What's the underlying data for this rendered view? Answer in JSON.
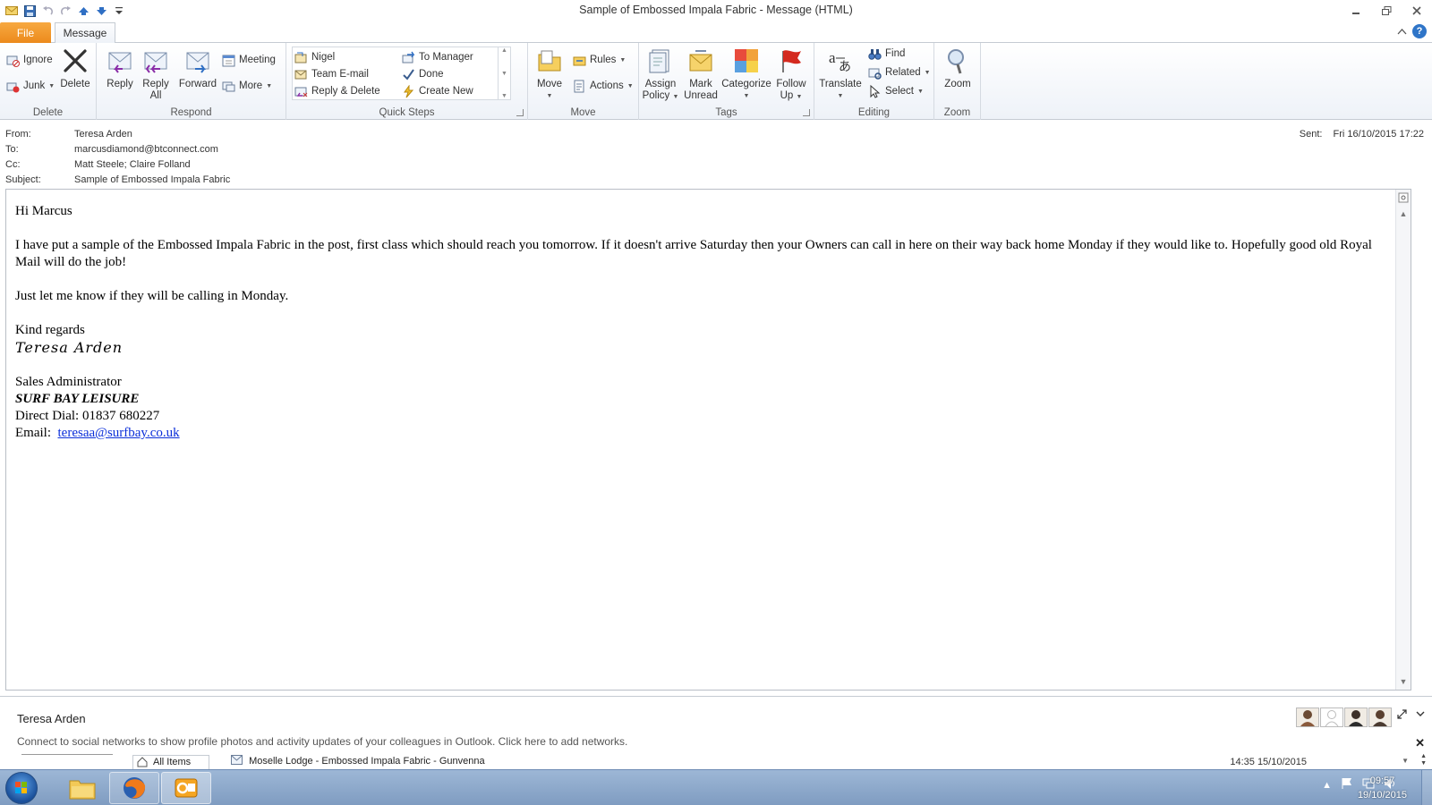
{
  "window": {
    "title": "Sample of Embossed Impala Fabric  -  Message (HTML)"
  },
  "tabs": {
    "file": "File",
    "message": "Message"
  },
  "ribbon": {
    "delete_group": {
      "label": "Delete",
      "ignore": "Ignore",
      "junk": "Junk",
      "delete": "Delete"
    },
    "respond_group": {
      "label": "Respond",
      "reply": "Reply",
      "reply_all_1": "Reply",
      "reply_all_2": "All",
      "forward": "Forward",
      "meeting": "Meeting",
      "more": "More"
    },
    "quick_steps_group": {
      "label": "Quick Steps",
      "items": [
        "Nigel",
        "To Manager",
        "Team E-mail",
        "Done",
        "Reply & Delete",
        "Create New"
      ]
    },
    "move_group": {
      "label": "Move",
      "move": "Move",
      "rules": "Rules",
      "actions": "Actions"
    },
    "tags_group": {
      "label": "Tags",
      "assign_policy_1": "Assign",
      "assign_policy_2": "Policy",
      "mark_unread_1": "Mark",
      "mark_unread_2": "Unread",
      "categorize": "Categorize",
      "follow_up_1": "Follow",
      "follow_up_2": "Up"
    },
    "editing_group": {
      "label": "Editing",
      "translate": "Translate",
      "find": "Find",
      "related": "Related",
      "select": "Select"
    },
    "zoom_group": {
      "label": "Zoom",
      "zoom": "Zoom"
    }
  },
  "header": {
    "from_label": "From:",
    "from": "Teresa Arden",
    "to_label": "To:",
    "to": "marcusdiamond@btconnect.com",
    "cc_label": "Cc:",
    "cc": "Matt Steele; Claire Folland",
    "subject_label": "Subject:",
    "subject": "Sample of Embossed Impala Fabric",
    "sent_label": "Sent:",
    "sent": "Fri 16/10/2015 17:22"
  },
  "body": {
    "greeting": "Hi Marcus",
    "paragraph1": "I have put a sample of the Embossed Impala Fabric in the post, first class which should reach you tomorrow.  If it doesn't arrive Saturday then your Owners can call in here on their way back home Monday if they would like to.  Hopefully good old Royal Mail will do the job!",
    "paragraph2": "Just let me know if they will be calling in Monday.",
    "closing": "Kind regards",
    "signature_name": "Teresa Arden",
    "sig_title": "Sales Administrator",
    "sig_company": "SURF BAY LEISURE",
    "sig_phone": "Direct Dial:  01837 680227",
    "sig_email_label": "Email:  ",
    "sig_email": "teresaa@surfbay.co.uk"
  },
  "people_pane": {
    "name": "Teresa Arden",
    "connect_text": "Connect to social networks to show profile photos and activity updates of your colleagues in Outlook. Click here to add networks.",
    "all_items": "All Items",
    "mail_item": "Moselle Lodge - Embossed Impala Fabric - Gunvenna",
    "mail_date": "14:35 15/10/2015"
  },
  "taskbar": {
    "time": "09:57",
    "date": "19/10/2015"
  },
  "colors": {
    "file_tab": "#ec8a1c",
    "link": "#0b2fd9",
    "taskbar": "#8fa9cc"
  }
}
